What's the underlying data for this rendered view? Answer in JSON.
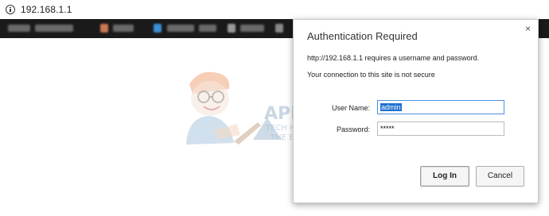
{
  "browser": {
    "url": "192.168.1.1"
  },
  "watermark": {
    "brand": "APPUALS",
    "tagline1": "TECH HOW-TO'S FROM",
    "tagline2": "THE EXPERTS!"
  },
  "dialog": {
    "title": "Authentication Required",
    "message": "http://192.168.1.1 requires a username and password.",
    "warning": "Your connection to this site is not secure",
    "username_label": "User Name:",
    "username_value": "admin",
    "password_label": "Password:",
    "password_value": "*****",
    "login_label": "Log In",
    "cancel_label": "Cancel",
    "close_symbol": "×"
  },
  "colors": {
    "selection": "#1e6fd0",
    "bookmarks_bar": "#1a1a1a",
    "logo_blue": "#9db7cf"
  },
  "icons": [
    "info-icon",
    "close-icon"
  ]
}
